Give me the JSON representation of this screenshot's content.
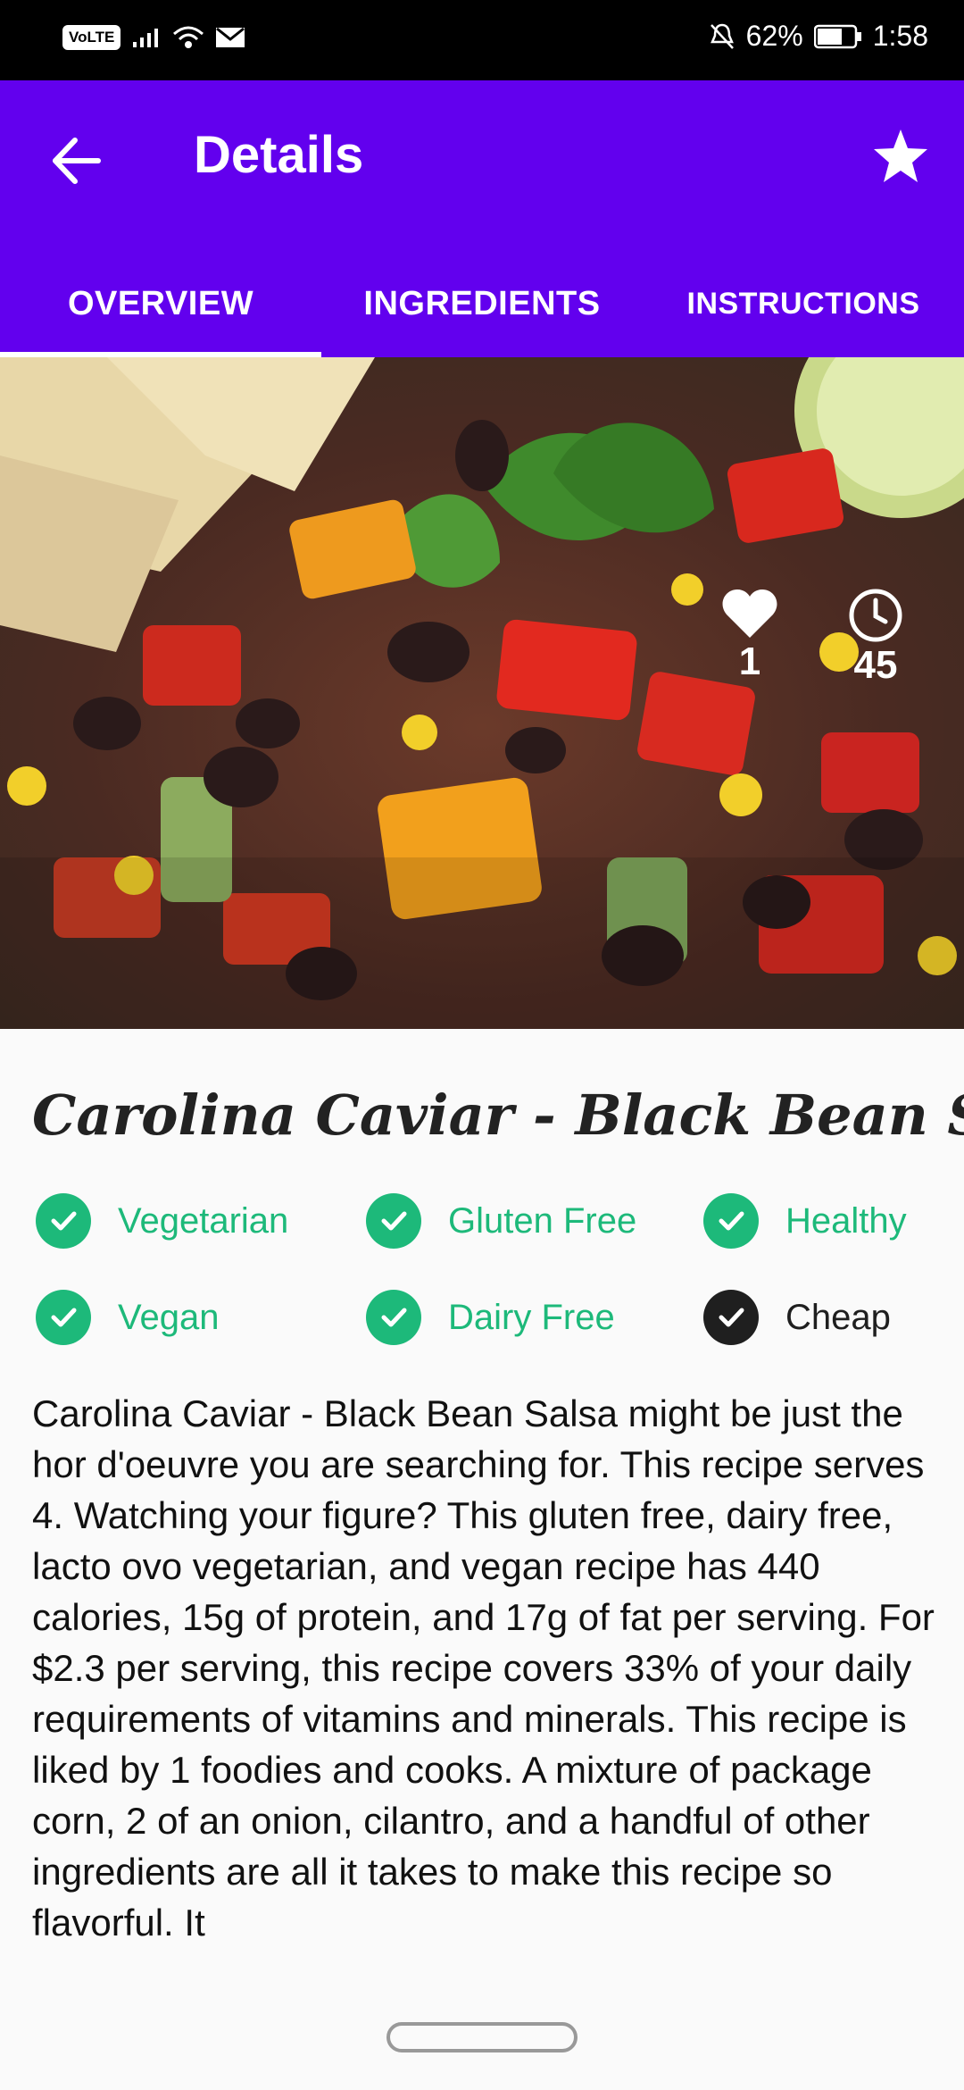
{
  "status_bar": {
    "volte": "VoLTE",
    "battery": "62%",
    "time": "1:58"
  },
  "app_bar": {
    "title": "Details",
    "back_icon": "arrow-back-icon",
    "favorite_icon": "star-icon"
  },
  "tabs": [
    {
      "label": "OVERVIEW",
      "selected": true
    },
    {
      "label": "INGREDIENTS",
      "selected": false
    },
    {
      "label": "INSTRUCTIONS",
      "selected": false
    }
  ],
  "stats": {
    "likes": "1",
    "minutes": "45"
  },
  "recipe": {
    "title": "Carolina Caviar - Black Bean Salsa",
    "tags": [
      {
        "label": "Vegetarian",
        "active": true
      },
      {
        "label": "Gluten Free",
        "active": true
      },
      {
        "label": "Healthy",
        "active": true
      },
      {
        "label": "Vegan",
        "active": true
      },
      {
        "label": "Dairy Free",
        "active": true
      },
      {
        "label": "Cheap",
        "active": false
      }
    ],
    "summary": "Carolina Caviar - Black Bean Salsa might be just the hor d'oeuvre you are searching for. This recipe serves 4. Watching your figure? This gluten free, dairy free, lacto ovo vegetarian, and vegan recipe has 440 calories, 15g of protein, and 17g of fat per serving. For $2.3 per serving, this recipe covers 33% of your daily requirements of vitamins and minerals. This recipe is liked by 1 foodies and cooks. A mixture of package corn, 2 of an onion, cilantro, and a handful of other ingredients are all it takes to make this recipe so flavorful. It"
  },
  "colors": {
    "primary": "#6200ee",
    "active_green": "#1db97a",
    "inactive_dark": "#1f1f1f"
  }
}
